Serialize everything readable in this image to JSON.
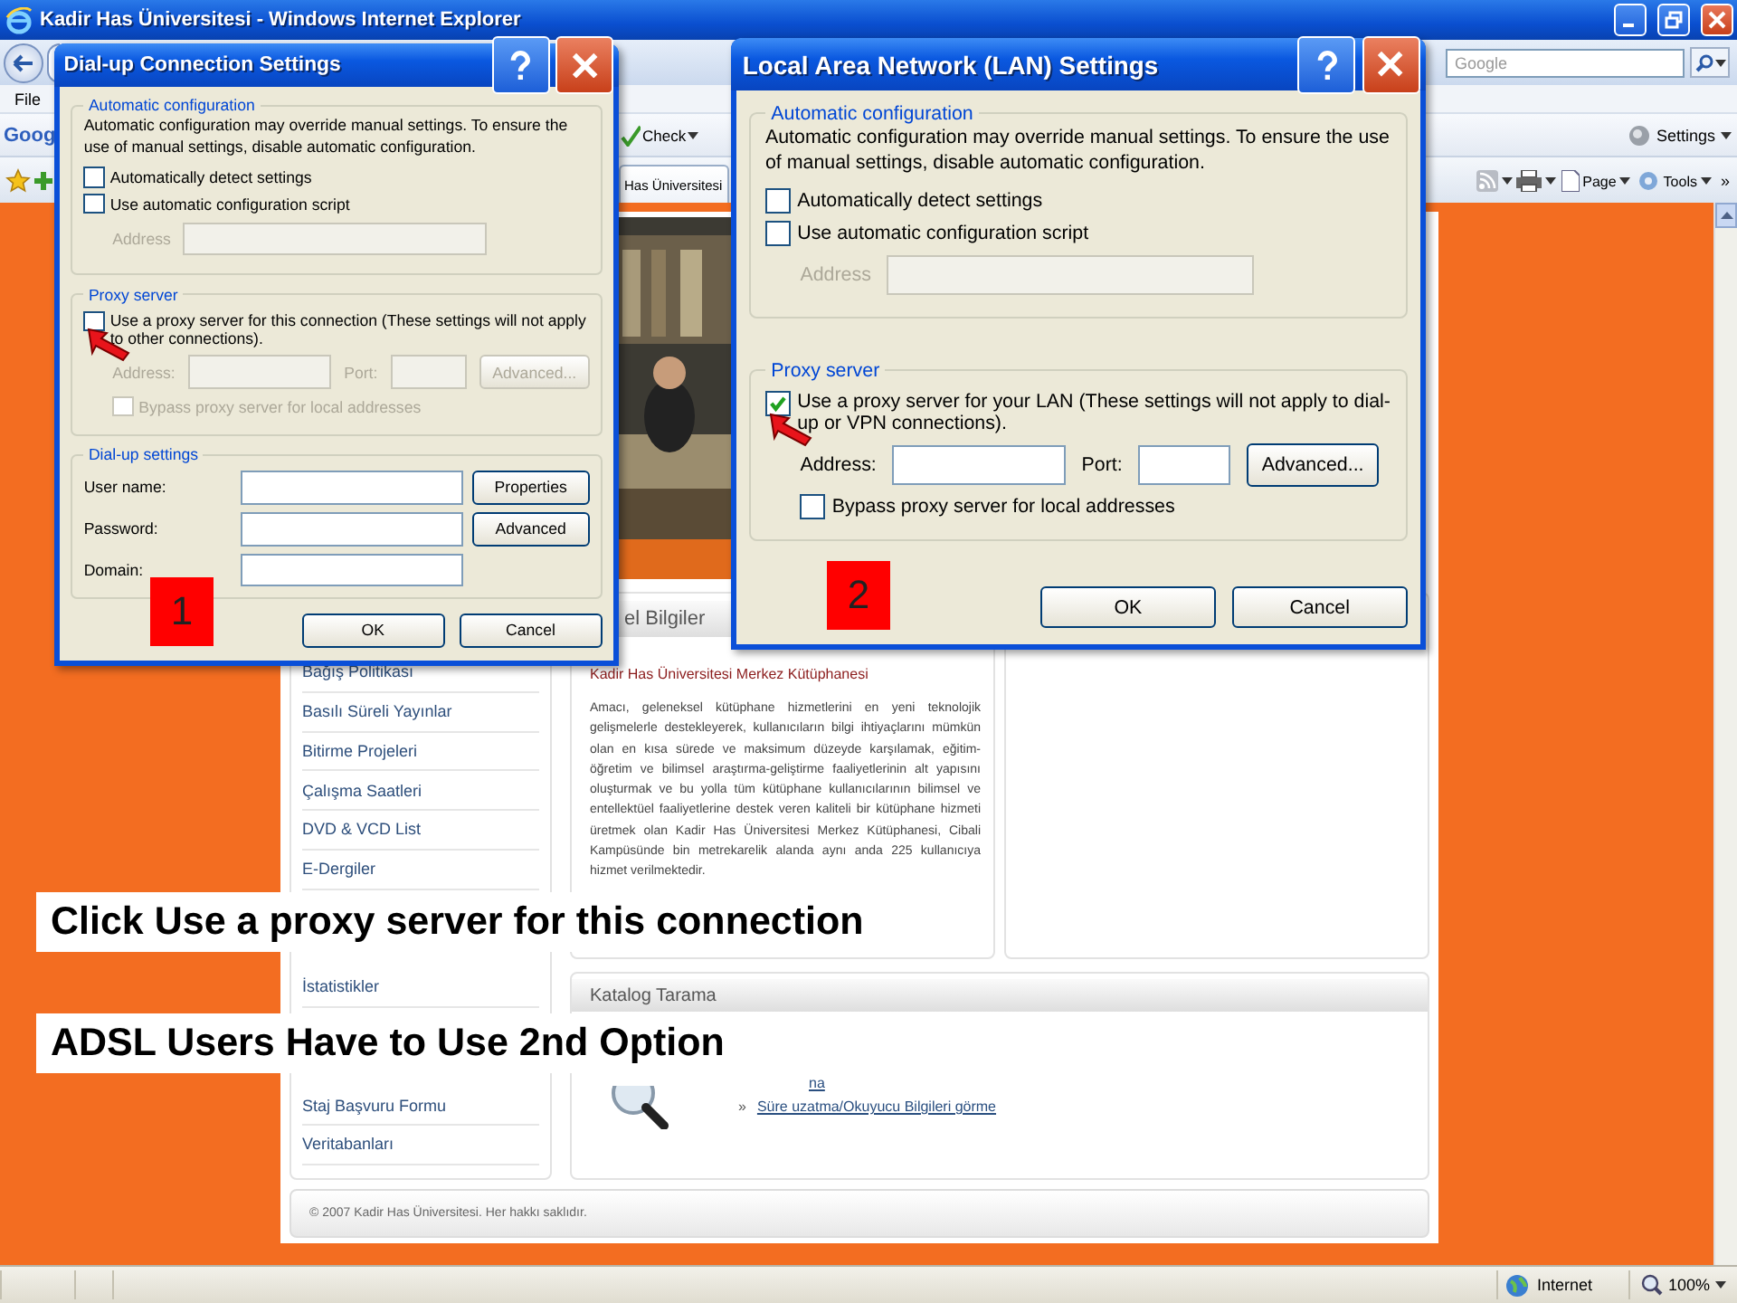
{
  "browser": {
    "title": "Kadir Has Üniversitesi - Windows Internet Explorer",
    "search": {
      "placeholder": "Google"
    },
    "menu": [
      "File"
    ],
    "google_toolbar": {
      "logo": "Goog",
      "check": "Check",
      "settings": "Settings"
    },
    "command_bar": {
      "tab": "Has Üniversitesi",
      "page": "Page",
      "tools": "Tools",
      "more": "»"
    },
    "status_bar": {
      "zone": "Internet",
      "zoom": "100%"
    }
  },
  "web_page": {
    "sidebar": {
      "items": [
        "Bağış Politikası",
        "Basılı Süreli Yayınlar",
        "Bitirme Projeleri",
        "Çalışma Saatleri",
        "DVD & VCD List",
        "E-Dergiler",
        "İstatistikler",
        "Staj Başvuru Formu",
        "Veritabanları"
      ]
    },
    "info_panel": {
      "title": "el Bilgiler",
      "heading": "Kadir Has Üniversitesi Merkez Kütüphanesi",
      "body": "Amacı, geleneksel kütüphane hizmetlerini en yeni teknolojik gelişmelerle destekleyerek, kullanıcıların bilgi ihtiyaçlarını mümkün olan en kısa sürede ve maksimum düzeyde karşılamak, eğitim-öğretim ve bilimsel araştırma-geliştirme faaliyetlerinin alt yapısını oluşturmak ve bu yolla tüm kütüphane kullanıcılarının bilimsel ve entellektüel faaliyetlerine destek veren kaliteli bir kütüphane hizmeti üretmek olan Kadir Has Üniversitesi Merkez Kütüphanesi, Cibali Kampüsünde bin metrekarelik alanda aynı anda 225 kullanıcıya hizmet verilmektedir."
    },
    "catalog_panel": {
      "title": "Katalog Tarama",
      "links": [
        {
          "text": "na"
        },
        {
          "bullet": "»",
          "text": "Süre uzatma/Okuyucu Bilgileri görme"
        }
      ]
    },
    "footer": "© 2007 Kadir Has Üniversitesi. Her hakkı saklıdır."
  },
  "dialogs": [
    {
      "kind": "dialup",
      "title": "Dial-up Connection Settings",
      "step": "1",
      "automatic_configuration": {
        "legend": "Automatic configuration",
        "text": "Automatic configuration may override manual settings.  To ensure the use of manual settings, disable automatic configuration.",
        "options": [
          {
            "label": "Automatically detect settings",
            "checked": false
          },
          {
            "label": "Use automatic configuration script",
            "checked": false
          }
        ],
        "address": {
          "label": "Address",
          "disabled": true
        }
      },
      "proxy_server": {
        "legend": "Proxy server",
        "disabled": true,
        "use_proxy": {
          "label": "Use a proxy server for this connection (These settings will not apply to other connections).",
          "checked": false
        },
        "address_label": "Address:",
        "port_label": "Port:",
        "advanced_button": "Advanced...",
        "bypass": {
          "label": "Bypass proxy server for local addresses",
          "checked": false
        }
      },
      "dialup_settings": {
        "legend": "Dial-up settings",
        "fields": [
          {
            "label": "User name:",
            "button": "Properties"
          },
          {
            "label": "Password:",
            "button": "Advanced"
          },
          {
            "label": "Domain:"
          }
        ]
      },
      "buttons": [
        "OK",
        "Cancel"
      ]
    },
    {
      "kind": "lan",
      "title": "Local Area Network (LAN) Settings",
      "step": "2",
      "automatic_configuration": {
        "legend": "Automatic configuration",
        "text": "Automatic configuration may override manual settings.  To ensure the use of manual settings, disable automatic configuration.",
        "options": [
          {
            "label": "Automatically detect settings",
            "checked": false
          },
          {
            "label": "Use automatic configuration script",
            "checked": false
          }
        ],
        "address": {
          "label": "Address",
          "disabled": true
        }
      },
      "proxy_server": {
        "legend": "Proxy server",
        "disabled": false,
        "use_proxy": {
          "label": "Use a proxy server for your LAN (These settings will not apply to dial-up or VPN connections).",
          "checked": true
        },
        "address_label": "Address:",
        "port_label": "Port:",
        "advanced_button": "Advanced...",
        "bypass": {
          "label": "Bypass proxy server for local addresses",
          "checked": false
        }
      },
      "buttons": [
        "OK",
        "Cancel"
      ]
    }
  ],
  "captions": [
    "Click Use a proxy server for this connection",
    "ADSL Users Have to Use 2nd Option"
  ]
}
